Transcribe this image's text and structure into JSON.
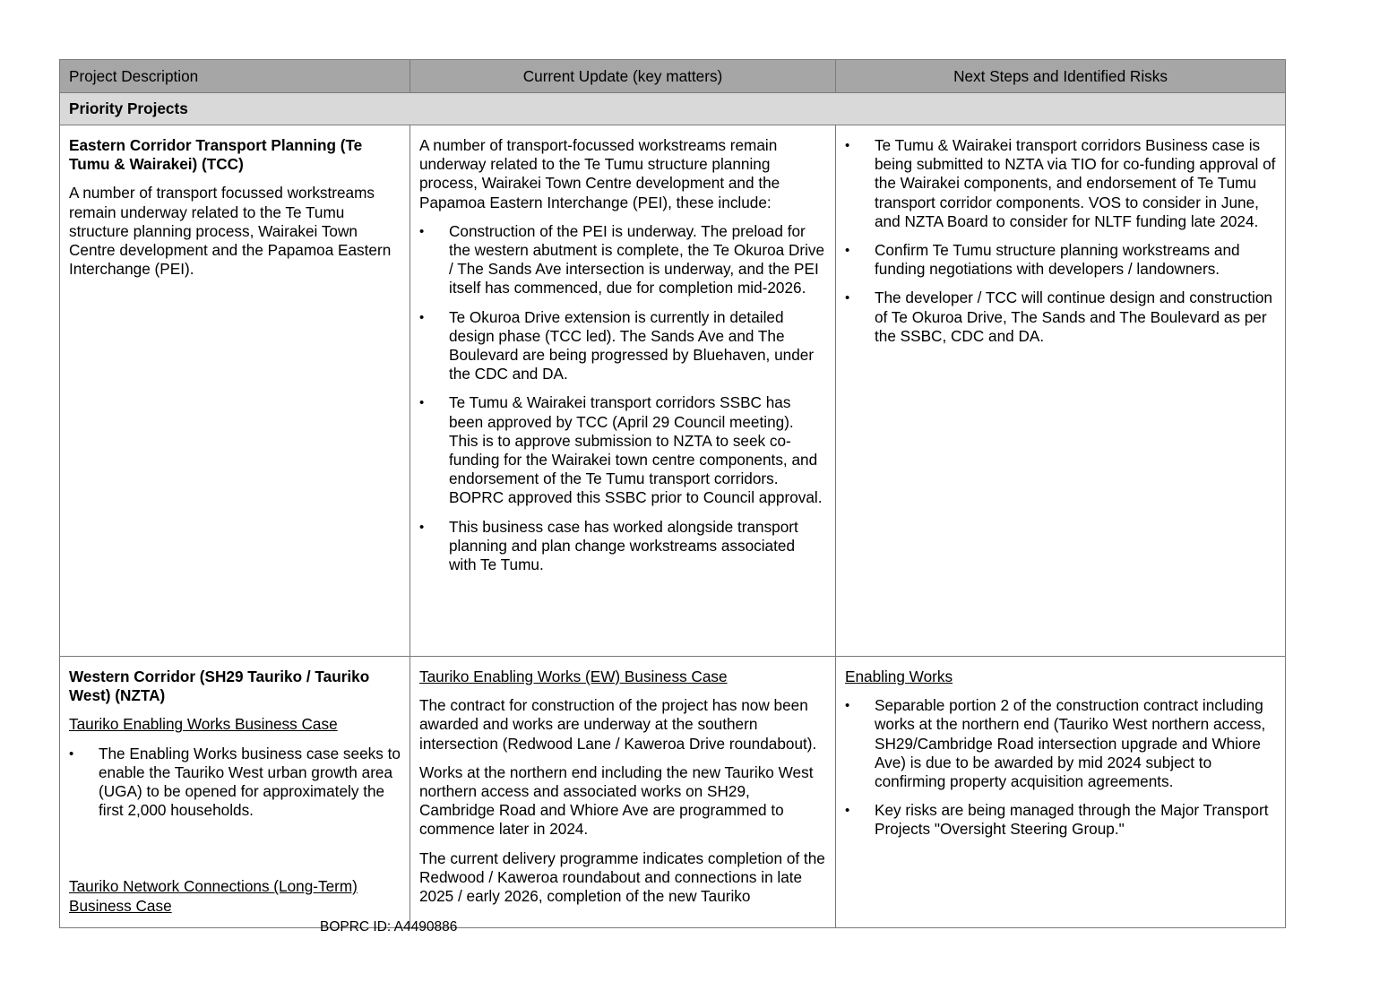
{
  "header": {
    "col1": "Project Description",
    "col2": "Current Update (key matters)",
    "col3": "Next Steps and Identified Risks"
  },
  "section": {
    "label": "Priority Projects"
  },
  "rows": [
    {
      "description": {
        "title": "Eastern Corridor Transport Planning (Te Tumu & Wairakei) (TCC)",
        "text": "A number of transport focussed workstreams remain underway related to the Te Tumu structure planning process, Wairakei Town Centre development and the Papamoa Eastern Interchange (PEI)."
      },
      "update": {
        "intro": "A number of transport-focussed workstreams remain underway related to the Te Tumu structure planning process, Wairakei Town Centre development and the Papamoa Eastern Interchange (PEI), these include:",
        "bullets": [
          "Construction of the PEI is underway. The preload for the western abutment is complete, the Te Okuroa Drive / The Sands Ave intersection is underway, and the PEI itself has commenced, due for completion mid-2026.",
          "Te Okuroa Drive extension is currently in detailed design phase (TCC led). The Sands Ave and The Boulevard are being progressed by Bluehaven, under the CDC and DA.",
          "Te Tumu & Wairakei transport corridors SSBC has been approved by TCC (April 29 Council meeting). This is to approve submission to NZTA to seek co-funding for the Wairakei town centre components, and endorsement of the Te Tumu transport corridors. BOPRC approved this SSBC prior to Council approval.",
          "This business case has worked alongside transport planning and plan change workstreams associated with Te Tumu."
        ]
      },
      "next": {
        "bullets": [
          "Te Tumu & Wairakei transport corridors Business case is being submitted to   NZTA via TIO for co-funding approval of the Wairakei components, and endorsement of Te Tumu transport corridor components. VOS to consider in June, and NZTA Board to consider for NLTF funding late 2024.",
          "Confirm Te Tumu structure planning workstreams and funding negotiations with developers / landowners.",
          "The developer / TCC will continue design and construction of Te Okuroa Drive, The Sands and The Boulevard as per the SSBC, CDC and DA."
        ]
      }
    },
    {
      "description": {
        "title": "Western Corridor (SH29 Tauriko / Tauriko West) (NZTA)",
        "subhead1": "Tauriko Enabling Works Business Case",
        "bullets": [
          "The Enabling Works business case seeks to enable the Tauriko West urban growth area (UGA) to be opened for approximately the first 2,000 households."
        ],
        "subhead2": "Tauriko Network Connections  (Long-Term) Business Case"
      },
      "update": {
        "subhead": "Tauriko Enabling Works (EW) Business Case",
        "paras": [
          "The contract for construction of the project has now been awarded and works are underway at the southern intersection (Redwood Lane / Kaweroa Drive roundabout).",
          "Works at the northern end including the new Tauriko West northern access and associated works on SH29, Cambridge Road and Whiore Ave are programmed to commence later in 2024.",
          "The current delivery programme indicates completion of the Redwood / Kaweroa roundabout and connections in late 2025 / early 2026, completion of the new Tauriko"
        ]
      },
      "next": {
        "subhead": "Enabling Works",
        "bullets": [
          "Separable portion 2 of the construction contract including works at the northern end (Tauriko West northern access, SH29/Cambridge Road intersection upgrade and Whiore Ave) is due to be awarded by mid 2024 subject to confirming property acquisition agreements.",
          "Key risks are being managed through the Major Transport Projects \"Oversight Steering Group.\""
        ]
      }
    }
  ],
  "footer": {
    "doc_id": "BOPRC ID: A4490886"
  }
}
